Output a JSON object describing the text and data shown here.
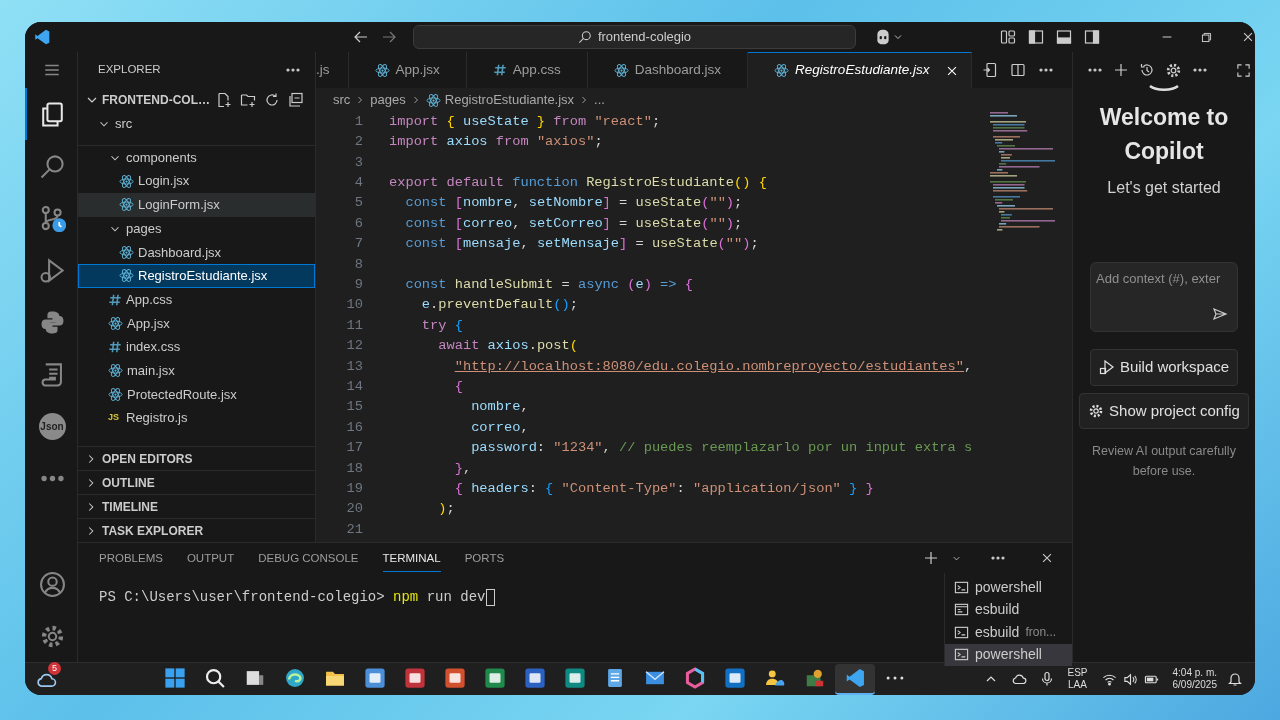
{
  "title_bar": {
    "search": "frontend-colegio"
  },
  "activity_bar": {
    "items": [
      {
        "kind": "files",
        "selected": true
      },
      {
        "kind": "search",
        "selected": false
      },
      {
        "kind": "source-control",
        "selected": false
      },
      {
        "kind": "run-debug",
        "selected": false
      },
      {
        "kind": "python",
        "selected": false
      },
      {
        "kind": "scroll",
        "selected": false
      },
      {
        "kind": "json",
        "label": "Json",
        "selected": false
      },
      {
        "kind": "more",
        "selected": false
      }
    ],
    "bottom": [
      {
        "kind": "account"
      },
      {
        "kind": "settings"
      }
    ]
  },
  "explorer": {
    "title": "EXPLORER",
    "root": {
      "label": "FRONTEND-COL…",
      "expanded": true
    },
    "tree": [
      {
        "label": "src",
        "kind": "folder",
        "expanded": true,
        "selected": false,
        "hovered": false,
        "children": [
          {
            "label": "components",
            "kind": "folder",
            "expanded": true,
            "selected": false,
            "hovered": false,
            "children": [
              {
                "label": "Login.jsx",
                "kind": "react",
                "selected": false,
                "hovered": false
              },
              {
                "label": "LoginForm.jsx",
                "kind": "react",
                "selected": false,
                "hovered": true
              }
            ]
          },
          {
            "label": "pages",
            "kind": "folder",
            "expanded": true,
            "selected": false,
            "hovered": false,
            "children": [
              {
                "label": "Dashboard.jsx",
                "kind": "react",
                "selected": false,
                "hovered": false
              },
              {
                "label": "RegistroEstudiante.jsx",
                "kind": "react",
                "selected": true,
                "hovered": false
              }
            ]
          },
          {
            "label": "App.css",
            "kind": "css",
            "selected": false,
            "hovered": false
          },
          {
            "label": "App.jsx",
            "kind": "react",
            "selected": false,
            "hovered": false
          },
          {
            "label": "index.css",
            "kind": "css",
            "selected": false,
            "hovered": false
          },
          {
            "label": "main.jsx",
            "kind": "react",
            "selected": false,
            "hovered": false
          },
          {
            "label": "ProtectedRoute.jsx",
            "kind": "react",
            "selected": false,
            "hovered": false
          },
          {
            "label": "Registro.js",
            "kind": "js",
            "icon_label": "JS",
            "selected": false,
            "hovered": false
          }
        ]
      }
    ],
    "sections": [
      {
        "label": "OPEN EDITORS",
        "expanded": false
      },
      {
        "label": "OUTLINE",
        "expanded": false
      },
      {
        "label": "TIMELINE",
        "expanded": false
      },
      {
        "label": "TASK EXPLORER",
        "expanded": false
      }
    ]
  },
  "editor": {
    "tabs": [
      {
        "label": ".js",
        "selected": false,
        "preview": false
      },
      {
        "label": "App.jsx",
        "kind": "react",
        "selected": false,
        "preview": false
      },
      {
        "label": "App.css",
        "kind": "css",
        "selected": false,
        "preview": false
      },
      {
        "label": "Dashboard.jsx",
        "kind": "react",
        "selected": false,
        "preview": false
      },
      {
        "label": "RegistroEstudiante.jsx",
        "kind": "react",
        "selected": true,
        "preview": true
      }
    ],
    "breadcrumb": [
      {
        "label": "src"
      },
      {
        "label": "pages"
      },
      {
        "label": "RegistroEstudiante.jsx",
        "kind": "react"
      },
      {
        "label": "..."
      }
    ],
    "lines": [
      {
        "number": "1",
        "tokens": [
          {
            "kind": "k",
            "text": "import "
          },
          {
            "kind": "b1",
            "text": "{"
          },
          {
            "kind": "v",
            "text": " useState "
          },
          {
            "kind": "b1",
            "text": "}"
          },
          {
            "kind": "k",
            "text": " from "
          },
          {
            "kind": "t",
            "text": "\"react\""
          },
          {
            "kind": "p",
            "text": ";"
          }
        ]
      },
      {
        "number": "2",
        "tokens": [
          {
            "kind": "k",
            "text": "import "
          },
          {
            "kind": "v",
            "text": "axios "
          },
          {
            "kind": "k",
            "text": "from "
          },
          {
            "kind": "t",
            "text": "\"axios\""
          },
          {
            "kind": "p",
            "text": ";"
          }
        ]
      },
      {
        "number": "3"
      },
      {
        "number": "4",
        "tokens": [
          {
            "kind": "k",
            "text": "export default "
          },
          {
            "kind": "s",
            "text": "function "
          },
          {
            "kind": "f",
            "text": "RegistroEstudiante"
          },
          {
            "kind": "b1",
            "text": "()"
          },
          {
            "kind": "b1",
            "text": " {"
          }
        ]
      },
      {
        "number": "5",
        "tokens": [
          {
            "kind": "s",
            "text": "  const "
          },
          {
            "kind": "b2",
            "text": "["
          },
          {
            "kind": "v",
            "text": "nombre"
          },
          {
            "kind": "p",
            "text": ", "
          },
          {
            "kind": "v",
            "text": "setNombre"
          },
          {
            "kind": "b2",
            "text": "]"
          },
          {
            "kind": "p",
            "text": " = "
          },
          {
            "kind": "f",
            "text": "useState"
          },
          {
            "kind": "b2",
            "text": "("
          },
          {
            "kind": "t",
            "text": "\"\""
          },
          {
            "kind": "b2",
            "text": ")"
          },
          {
            "kind": "p",
            "text": ";"
          }
        ]
      },
      {
        "number": "6",
        "tokens": [
          {
            "kind": "s",
            "text": "  const "
          },
          {
            "kind": "b2",
            "text": "["
          },
          {
            "kind": "v",
            "text": "correo"
          },
          {
            "kind": "p",
            "text": ", "
          },
          {
            "kind": "v",
            "text": "setCorreo"
          },
          {
            "kind": "b2",
            "text": "]"
          },
          {
            "kind": "p",
            "text": " = "
          },
          {
            "kind": "f",
            "text": "useState"
          },
          {
            "kind": "b2",
            "text": "("
          },
          {
            "kind": "t",
            "text": "\"\""
          },
          {
            "kind": "b2",
            "text": ")"
          },
          {
            "kind": "p",
            "text": ";"
          }
        ]
      },
      {
        "number": "7",
        "tokens": [
          {
            "kind": "s",
            "text": "  const "
          },
          {
            "kind": "b2",
            "text": "["
          },
          {
            "kind": "v",
            "text": "mensaje"
          },
          {
            "kind": "p",
            "text": ", "
          },
          {
            "kind": "v",
            "text": "setMensaje"
          },
          {
            "kind": "b2",
            "text": "]"
          },
          {
            "kind": "p",
            "text": " = "
          },
          {
            "kind": "f",
            "text": "useState"
          },
          {
            "kind": "b2",
            "text": "("
          },
          {
            "kind": "t",
            "text": "\"\""
          },
          {
            "kind": "b2",
            "text": ")"
          },
          {
            "kind": "p",
            "text": ";"
          }
        ]
      },
      {
        "number": "8"
      },
      {
        "number": "9",
        "tokens": [
          {
            "kind": "s",
            "text": "  const "
          },
          {
            "kind": "f",
            "text": "handleSubmit"
          },
          {
            "kind": "p",
            "text": " = "
          },
          {
            "kind": "s",
            "text": "async "
          },
          {
            "kind": "b2",
            "text": "("
          },
          {
            "kind": "v",
            "text": "e"
          },
          {
            "kind": "b2",
            "text": ")"
          },
          {
            "kind": "s",
            "text": " => "
          },
          {
            "kind": "b2",
            "text": "{"
          }
        ]
      },
      {
        "number": "10",
        "tokens": [
          {
            "kind": "v",
            "text": "    e"
          },
          {
            "kind": "p",
            "text": "."
          },
          {
            "kind": "f",
            "text": "preventDefault"
          },
          {
            "kind": "b3",
            "text": "()"
          },
          {
            "kind": "p",
            "text": ";"
          }
        ]
      },
      {
        "number": "11",
        "tokens": [
          {
            "kind": "k",
            "text": "    try "
          },
          {
            "kind": "b3",
            "text": "{"
          }
        ]
      },
      {
        "number": "12",
        "tokens": [
          {
            "kind": "k",
            "text": "      await "
          },
          {
            "kind": "v",
            "text": "axios"
          },
          {
            "kind": "p",
            "text": "."
          },
          {
            "kind": "f",
            "text": "post"
          },
          {
            "kind": "b1",
            "text": "("
          }
        ]
      },
      {
        "number": "13",
        "tokens": [
          {
            "kind": "u",
            "text": "\"http://localhost:8080/edu.colegio.nombreproyecto/estudiantes\""
          },
          {
            "kind": "p",
            "text": ","
          }
        ]
      },
      {
        "number": "14",
        "tokens": [
          {
            "kind": "b2",
            "text": "        {"
          }
        ]
      },
      {
        "number": "15",
        "tokens": [
          {
            "kind": "v",
            "text": "          nombre"
          },
          {
            "kind": "p",
            "text": ","
          }
        ]
      },
      {
        "number": "16",
        "tokens": [
          {
            "kind": "v",
            "text": "          correo"
          },
          {
            "kind": "p",
            "text": ","
          }
        ]
      },
      {
        "number": "17",
        "tokens": [
          {
            "kind": "v",
            "text": "          password"
          },
          {
            "kind": "p",
            "text": ": "
          },
          {
            "kind": "t",
            "text": "\"1234\""
          },
          {
            "kind": "p",
            "text": ", "
          },
          {
            "kind": "c",
            "text": "// puedes reemplazarlo por un input extra s"
          }
        ]
      },
      {
        "number": "18",
        "tokens": [
          {
            "kind": "b2",
            "text": "        }"
          },
          {
            "kind": "p",
            "text": ","
          }
        ]
      },
      {
        "number": "19",
        "tokens": [
          {
            "kind": "b2",
            "text": "        {"
          },
          {
            "kind": "v",
            "text": " headers"
          },
          {
            "kind": "p",
            "text": ": "
          },
          {
            "kind": "b3",
            "text": "{"
          },
          {
            "kind": "t",
            "text": " \"Content-Type\""
          },
          {
            "kind": "p",
            "text": ": "
          },
          {
            "kind": "t",
            "text": "\"application/json\""
          },
          {
            "kind": "b3",
            "text": " }"
          },
          {
            "kind": "b2",
            "text": " }"
          }
        ]
      },
      {
        "number": "20",
        "tokens": [
          {
            "kind": "b1",
            "text": "      )"
          },
          {
            "kind": "p",
            "text": ";"
          }
        ]
      },
      {
        "number": "21"
      }
    ]
  },
  "copilot": {
    "title": "Welcome to Copilot",
    "subtitle": "Let's get started",
    "input": {
      "placeholder": "Add context (#), exter"
    },
    "buttons": [
      {
        "label": "Build workspace",
        "kind": "build"
      },
      {
        "label": "Show project config",
        "kind": "settings"
      }
    ],
    "note": "Review AI output carefully before use."
  },
  "panel": {
    "tabs": [
      {
        "label": "PROBLEMS",
        "selected": false
      },
      {
        "label": "OUTPUT",
        "selected": false
      },
      {
        "label": "DEBUG CONSOLE",
        "selected": false
      },
      {
        "label": "TERMINAL",
        "selected": true
      },
      {
        "label": "PORTS",
        "selected": false
      }
    ],
    "terminal": {
      "prompt": "PS C:\\Users\\user\\frontend-colegio>",
      "command": "npm",
      "args": "run dev"
    },
    "sessions": [
      {
        "label": "powershell",
        "kind": "powershell",
        "selected": false
      },
      {
        "label": "esbuild",
        "kind": "cmd",
        "selected": false
      },
      {
        "label": "esbuild",
        "detail": "fron...",
        "kind": "powershell",
        "selected": false
      },
      {
        "label": "powershell",
        "kind": "powershell",
        "selected": true
      }
    ]
  },
  "taskbar": {
    "weather": {
      "badge": "5"
    },
    "apps": [
      {
        "kind": "start",
        "active": false
      },
      {
        "kind": "search",
        "active": false
      },
      {
        "kind": "taskview",
        "active": false
      },
      {
        "kind": "browser",
        "active": false
      },
      {
        "kind": "folder",
        "active": false
      },
      {
        "kind": "tile",
        "color": "#4a8fd8",
        "active": false
      },
      {
        "kind": "tile",
        "color": "#c0333a",
        "active": false
      },
      {
        "kind": "tile",
        "color": "#d2502e",
        "active": false
      },
      {
        "kind": "tile",
        "color": "#1f8a4c",
        "active": false
      },
      {
        "kind": "tile",
        "color": "#2b62c2",
        "active": false
      },
      {
        "kind": "tile",
        "color": "#0f8a83",
        "active": false
      },
      {
        "kind": "notepad",
        "active": false
      },
      {
        "kind": "mail",
        "active": false
      },
      {
        "kind": "hexagon",
        "active": false
      },
      {
        "kind": "tile",
        "color": "#1270c4",
        "active": false
      },
      {
        "kind": "people",
        "active": false
      },
      {
        "kind": "tool",
        "active": false
      },
      {
        "kind": "vscode",
        "active": true
      },
      {
        "kind": "more",
        "active": false
      }
    ],
    "tray": {
      "language": "ESP",
      "layout": "LAA",
      "time": "4:04 p. m.",
      "date": "6/09/2025"
    }
  }
}
